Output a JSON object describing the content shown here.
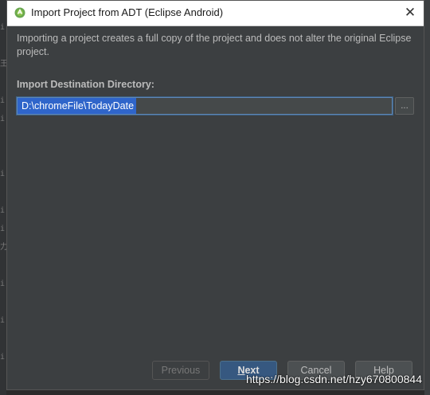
{
  "window": {
    "title": "Import Project from ADT (Eclipse Android)",
    "close_glyph": "✕",
    "icon": "android-studio-icon"
  },
  "main": {
    "description": "Importing a project creates a full copy of the project and does not alter the original Eclipse project.",
    "destination_label": "Import Destination Directory:",
    "destination_value": "D:\\chromeFile\\TodayDate",
    "browse_label": "..."
  },
  "buttons": {
    "previous": "Previous",
    "next_first": "N",
    "next_rest": "ext",
    "cancel": "Cancel",
    "help": "Help"
  },
  "background": {
    "strip_glyphs": [
      "",
      "i",
      "",
      "王",
      "",
      "i",
      "i",
      "",
      "",
      "i",
      "",
      "i",
      "i",
      "力",
      "",
      "i",
      "",
      "i",
      "",
      "i"
    ]
  },
  "watermark": "https://blog.csdn.net/hzy670800844",
  "colors": {
    "dialog_bg": "#3c3f41",
    "titlebar_bg": "#ffffff",
    "selection": "#2f65ca",
    "primary_button": "#365880"
  }
}
